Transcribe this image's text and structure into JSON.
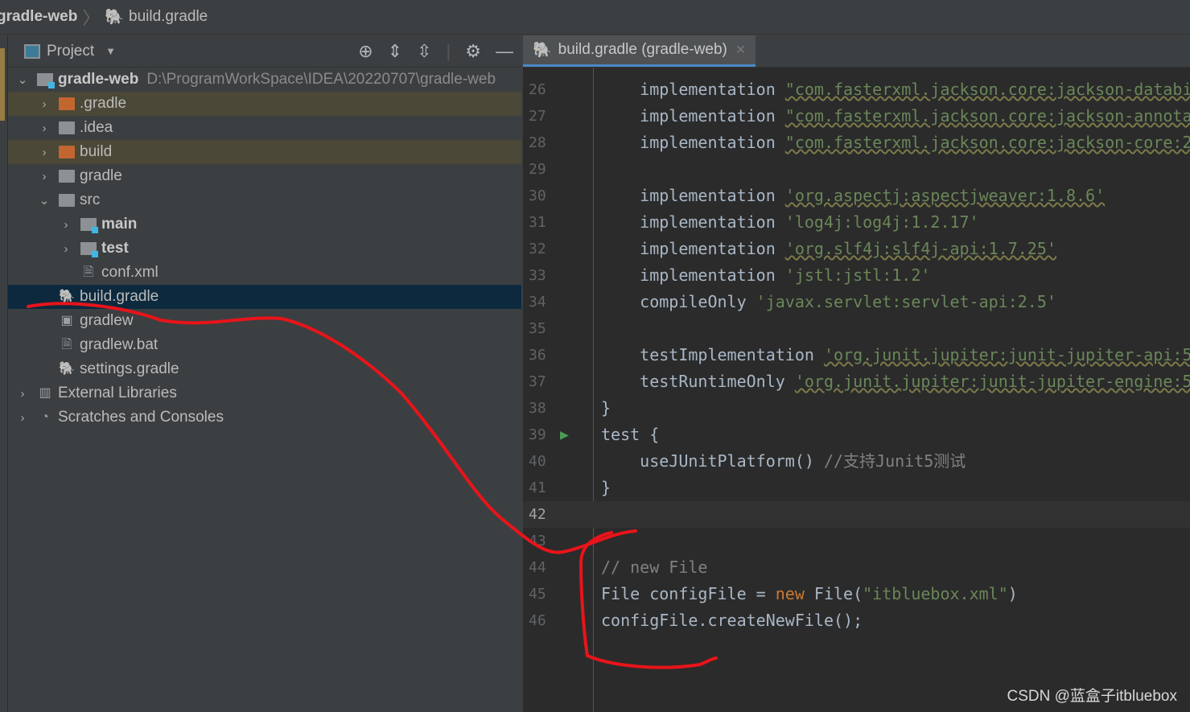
{
  "breadcrumb": {
    "project": "gradle-web",
    "file": "build.gradle",
    "file_icon": "gradle-elephant-icon"
  },
  "project_panel": {
    "title": "Project",
    "tools": [
      "locate-icon",
      "expand-all-icon",
      "collapse-all-icon",
      "gear-icon",
      "minimize-icon"
    ],
    "tree": [
      {
        "label": "gradle-web",
        "path": "D:\\ProgramWorkSpace\\IDEA\\20220707\\gradle-web",
        "level": 0,
        "arrow": "expanded",
        "icon": "module",
        "bold": true
      },
      {
        "label": ".gradle",
        "level": 1,
        "arrow": "collapsed",
        "icon": "folder-orange",
        "highlight": true
      },
      {
        "label": ".idea",
        "level": 1,
        "arrow": "collapsed",
        "icon": "folder"
      },
      {
        "label": "build",
        "level": 1,
        "arrow": "collapsed",
        "icon": "folder-orange",
        "highlight": true
      },
      {
        "label": "gradle",
        "level": 1,
        "arrow": "collapsed",
        "icon": "folder"
      },
      {
        "label": "src",
        "level": 1,
        "arrow": "expanded",
        "icon": "folder"
      },
      {
        "label": "main",
        "level": 2,
        "arrow": "collapsed",
        "icon": "module",
        "bold": true
      },
      {
        "label": "test",
        "level": 2,
        "arrow": "collapsed",
        "icon": "module",
        "bold": true
      },
      {
        "label": "conf.xml",
        "level": 2,
        "icon": "xml"
      },
      {
        "label": "build.gradle",
        "level": 1,
        "icon": "gradle",
        "selected": true
      },
      {
        "label": "gradlew",
        "level": 1,
        "icon": "terminal"
      },
      {
        "label": "gradlew.bat",
        "level": 1,
        "icon": "text"
      },
      {
        "label": "settings.gradle",
        "level": 1,
        "icon": "gradle"
      },
      {
        "label": "External Libraries",
        "level": 0,
        "arrow": "collapsed",
        "icon": "libraries"
      },
      {
        "label": "Scratches and Consoles",
        "level": 0,
        "arrow": "collapsed",
        "icon": "scratches"
      }
    ]
  },
  "editor": {
    "tab": "build.gradle (gradle-web)",
    "current_line": 42,
    "lines": [
      {
        "n": 26,
        "tokens": [
          [
            "    implementation ",
            ""
          ],
          [
            "\"com.fasterxml.jackson.core:jackson-databi",
            "sq"
          ]
        ]
      },
      {
        "n": 27,
        "tokens": [
          [
            "    implementation ",
            ""
          ],
          [
            "\"com.fasterxml.jackson.core:jackson-annota",
            "sq"
          ]
        ]
      },
      {
        "n": 28,
        "tokens": [
          [
            "    implementation ",
            ""
          ],
          [
            "\"com.fasterxml.jackson.core:jackson-core:2",
            "sq"
          ]
        ]
      },
      {
        "n": 29,
        "tokens": []
      },
      {
        "n": 30,
        "tokens": [
          [
            "    implementation ",
            ""
          ],
          [
            "'org.aspectj:aspectjweaver:1.8.6'",
            "sq"
          ]
        ]
      },
      {
        "n": 31,
        "tokens": [
          [
            "    implementation ",
            ""
          ],
          [
            "'log4j:log4j:1.2.17'",
            "str"
          ]
        ]
      },
      {
        "n": 32,
        "tokens": [
          [
            "    implementation ",
            ""
          ],
          [
            "'org.slf4j:slf4j-api:1.7.25'",
            "sq"
          ]
        ]
      },
      {
        "n": 33,
        "tokens": [
          [
            "    implementation ",
            ""
          ],
          [
            "'jstl:jstl:1.2'",
            "str"
          ]
        ]
      },
      {
        "n": 34,
        "tokens": [
          [
            "    compileOnly ",
            ""
          ],
          [
            "'javax.servlet:servlet-api:2.5'",
            "str"
          ]
        ]
      },
      {
        "n": 35,
        "tokens": []
      },
      {
        "n": 36,
        "tokens": [
          [
            "    testImplementation ",
            ""
          ],
          [
            "'org.junit.jupiter:junit-jupiter-api:5",
            "sq"
          ]
        ]
      },
      {
        "n": 37,
        "tokens": [
          [
            "    testRuntimeOnly ",
            ""
          ],
          [
            "'org.junit.jupiter:junit-jupiter-engine:5",
            "sq"
          ]
        ]
      },
      {
        "n": 38,
        "tokens": [
          [
            "}",
            ""
          ]
        ]
      },
      {
        "n": 39,
        "tokens": [
          [
            "test {",
            ""
          ]
        ],
        "run": true
      },
      {
        "n": 40,
        "tokens": [
          [
            "    useJUnitPlatform() ",
            ""
          ],
          [
            "//支持Junit5测试",
            "cm"
          ]
        ]
      },
      {
        "n": 41,
        "tokens": [
          [
            "}",
            ""
          ]
        ]
      },
      {
        "n": 42,
        "tokens": []
      },
      {
        "n": 43,
        "tokens": []
      },
      {
        "n": 44,
        "tokens": [
          [
            "// new File",
            "cm"
          ]
        ]
      },
      {
        "n": 45,
        "tokens": [
          [
            "File configFile = ",
            ""
          ],
          [
            "new",
            "kw"
          ],
          [
            " File(",
            ""
          ],
          [
            "\"itbluebox.xml\"",
            "str"
          ],
          [
            ")",
            ""
          ]
        ]
      },
      {
        "n": 46,
        "tokens": [
          [
            "configFile.createNewFile();",
            ""
          ]
        ]
      }
    ]
  },
  "watermark": "CSDN @蓝盒子itbluebox",
  "colors": {
    "annotation": "#e8141a",
    "selection": "#0d293e",
    "string": "#6a8759",
    "keyword": "#cc7832"
  }
}
